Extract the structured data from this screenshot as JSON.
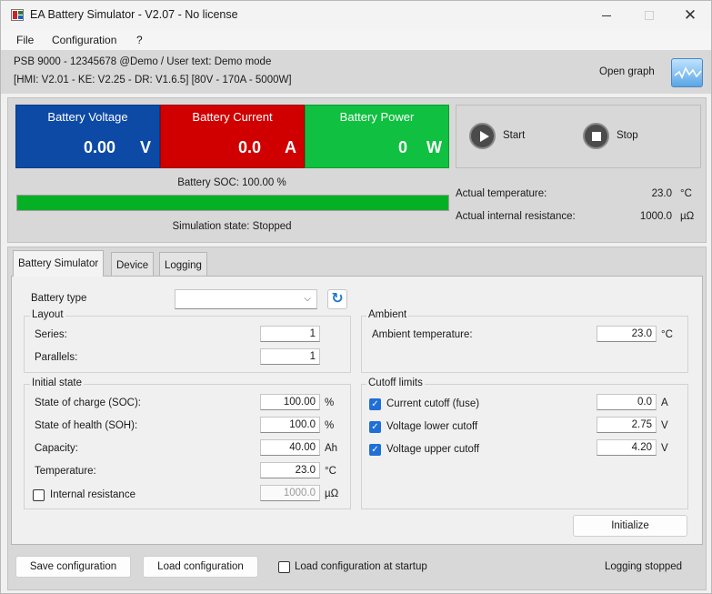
{
  "window": {
    "title": "EA Battery Simulator - V2.07 - No license",
    "minimize": "—",
    "maximize": "☐",
    "close": "✕"
  },
  "menu": {
    "items": [
      "File",
      "Configuration",
      "?"
    ]
  },
  "info": {
    "device_line": "PSB 9000 - 12345678 @Demo / User text: Demo mode",
    "version_line": "[HMI: V2.01 - KE: V2.25 - DR: V1.6.5] [80V - 170A - 5000W]",
    "open_graph": "Open graph"
  },
  "tiles": {
    "voltage": {
      "title": "Battery Voltage",
      "value": "0.00",
      "unit": "V",
      "color": "#0d4aa6"
    },
    "current": {
      "title": "Battery Current",
      "value": "0.0",
      "unit": "A",
      "color": "#d00000"
    },
    "power": {
      "title": "Battery Power",
      "value": "0",
      "unit": "W",
      "color": "#10c040"
    }
  },
  "controls": {
    "start": "Start",
    "stop": "Stop"
  },
  "status": {
    "soc_label": "Battery SOC: 100.00 %",
    "soc_fraction": 1.0,
    "sim_state": "Simulation state: Stopped",
    "temp_label": "Actual temperature:",
    "temp_value": "23.0",
    "temp_unit": "°C",
    "res_label": "Actual internal resistance:",
    "res_value": "1000.0",
    "res_unit": "µΩ"
  },
  "tabs": [
    "Battery Simulator",
    "Device",
    "Logging"
  ],
  "form": {
    "battery_type_label": "Battery type",
    "battery_type_value": "",
    "layout": {
      "title": "Layout",
      "series_label": "Series:",
      "series_value": "1",
      "parallels_label": "Parallels:",
      "parallels_value": "1"
    },
    "ambient": {
      "title": "Ambient",
      "temp_label": "Ambient temperature:",
      "temp_value": "23.0",
      "temp_unit": "°C"
    },
    "initial": {
      "title": "Initial state",
      "soc_label": "State of charge (SOC):",
      "soc_value": "100.00",
      "soc_unit": "%",
      "soh_label": "State of health (SOH):",
      "soh_value": "100.0",
      "soh_unit": "%",
      "cap_label": "Capacity:",
      "cap_value": "40.00",
      "cap_unit": "Ah",
      "temp_label": "Temperature:",
      "temp_value": "23.0",
      "temp_unit": "°C",
      "ir_label": "Internal resistance",
      "ir_value": "1000.0",
      "ir_unit": "µΩ"
    },
    "cutoff": {
      "title": "Cutoff limits",
      "current_label": "Current cutoff (fuse)",
      "current_value": "0.0",
      "current_unit": "A",
      "vlow_label": "Voltage lower cutoff",
      "vlow_value": "2.75",
      "vlow_unit": "V",
      "vup_label": "Voltage upper cutoff",
      "vup_value": "4.20",
      "vup_unit": "V"
    },
    "initialize": "Initialize"
  },
  "footer": {
    "save": "Save configuration",
    "load": "Load configuration",
    "load_startup": "Load configuration at startup",
    "logging": "Logging stopped"
  },
  "check_mark": "✓",
  "icons": {
    "refresh": "↻",
    "combo_arrow": "⌵"
  }
}
